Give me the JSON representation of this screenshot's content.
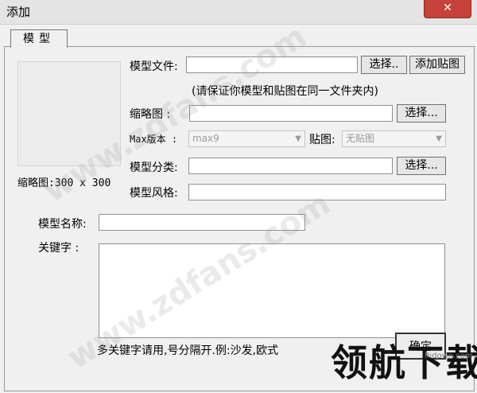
{
  "window": {
    "title": "添加",
    "close_glyph": "✕"
  },
  "tab": {
    "label": "模型"
  },
  "thumbnail": {
    "caption": "缩略图:300 x 300"
  },
  "model_file": {
    "label": "模型文件:",
    "value": "",
    "browse_label": "选择..",
    "add_texture_label": "添加贴图"
  },
  "note": "(请保证你模型和贴图在同一文件夹内)",
  "thumbnail_field": {
    "label": "缩略图  :",
    "value": "",
    "browse_label": "选择..."
  },
  "max_version": {
    "label": "Max版本 :",
    "selected": "max9"
  },
  "texture": {
    "label": "贴图:",
    "selected": "无贴图"
  },
  "category": {
    "label": "模型分类:",
    "value": "",
    "browse_label": "选择..."
  },
  "style": {
    "label": "模型风格:",
    "value": ""
  },
  "model_name": {
    "label": "模型名称:",
    "value": ""
  },
  "keywords": {
    "label": "关键字  :",
    "value": ""
  },
  "hint": "多关键字请用,号分隔开.例:沙发,欧式",
  "ok_label": "确定",
  "watermark": {
    "text": "www.zdfans.com",
    "logo": "领航下载",
    "site": "lhdown.com"
  },
  "colors": {
    "close_button": "#c7423a",
    "panel_bg": "#f0f0f0"
  }
}
